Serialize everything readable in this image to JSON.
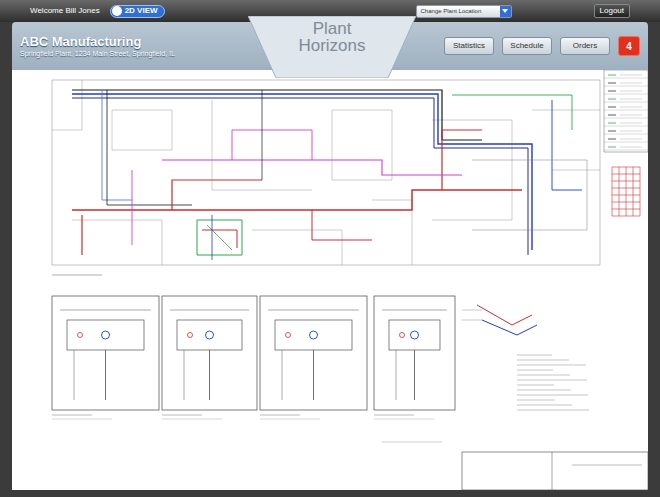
{
  "top_bar": {
    "welcome": "Welcome Bill Jones",
    "view_toggle": {
      "label": "2D VIEW",
      "on": true
    },
    "location_select": {
      "value": "Change Plant Location"
    },
    "logout": "Logout"
  },
  "header": {
    "company": "ABC Manufacturing",
    "address": "Springfield Plant, 1234 Main Street, Springfield, IL",
    "logo": [
      "Plant",
      "Horizons"
    ],
    "nav": [
      {
        "label": "Statistics"
      },
      {
        "label": "Schedule"
      },
      {
        "label": "Orders"
      }
    ],
    "badge": "4"
  },
  "document": {
    "kind": "floor-plan-drawing"
  }
}
